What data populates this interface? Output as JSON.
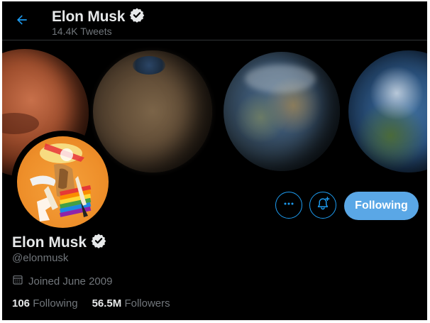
{
  "header": {
    "name": "Elon Musk",
    "tweet_count": "14.4K",
    "tweet_label": "Tweets"
  },
  "profile": {
    "name": "Elon Musk",
    "handle": "@elonmusk",
    "joined": "Joined June 2009",
    "verified": true
  },
  "buttons": {
    "following_label": "Following"
  },
  "stats": [
    {
      "count": "106",
      "label": "Following"
    },
    {
      "count": "56.5M",
      "label": "Followers"
    }
  ],
  "colors": {
    "accent": "#1d9bf0",
    "following_button": "#5aa7e6",
    "background": "#000000",
    "primary_text": "#e7e9ea",
    "secondary_text": "#71767b"
  },
  "icons": {
    "back": "arrow-left-icon",
    "verified": "verified-badge-icon",
    "more": "more-horizontal-icon",
    "notifications": "bell-plus-icon",
    "calendar": "calendar-icon"
  }
}
